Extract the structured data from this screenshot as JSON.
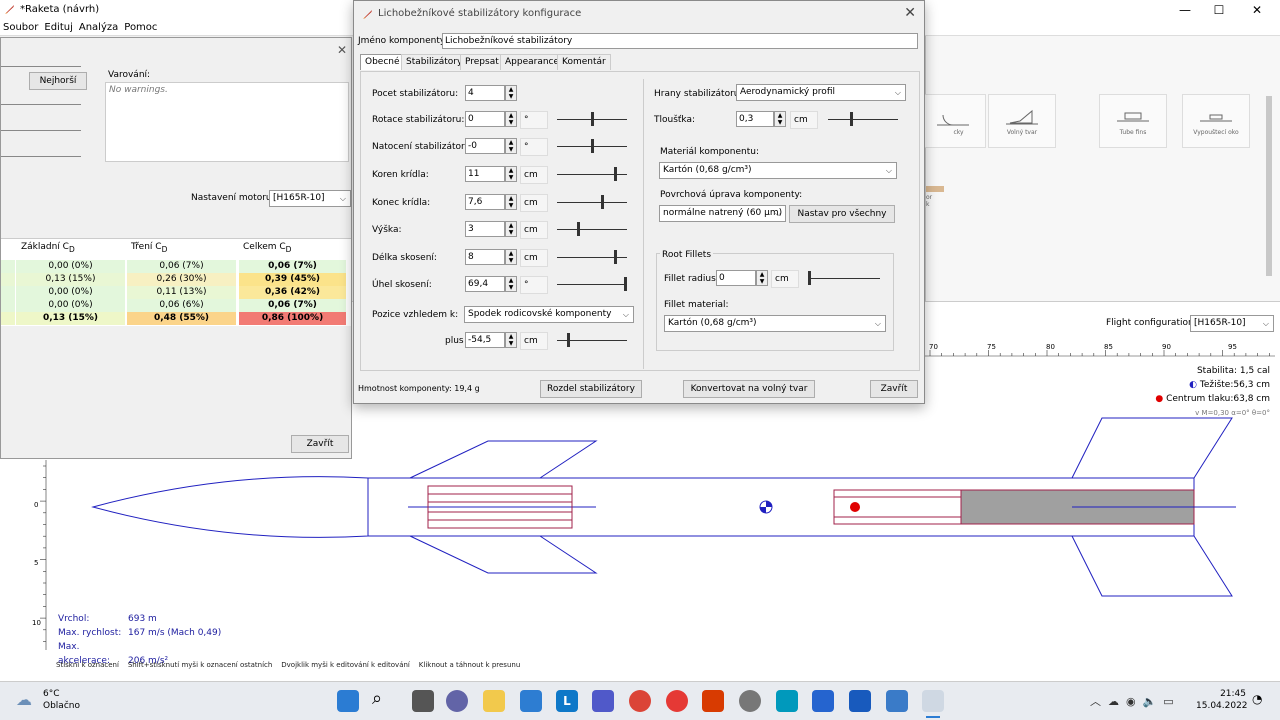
{
  "main_window": {
    "title": "*Raketa (návrh)",
    "controls": {
      "minimize": "—",
      "maximize": "☐",
      "close": "✕"
    },
    "menu": [
      "Soubor",
      "Edituj",
      "Analýza",
      "Pomoc"
    ]
  },
  "analysis_dialog": {
    "worst_button": "Nejhorší",
    "warnings_label": "Varování:",
    "warnings_text": "No warnings.",
    "motor_label": "Nastavení motoru:",
    "motor_value": "[H165R-10]",
    "close_button": "Zavřít",
    "columns": [
      {
        "main": "Základní C",
        "sub": "D"
      },
      {
        "main": "Tření C",
        "sub": "D"
      },
      {
        "main": "Celkem C",
        "sub": "D"
      }
    ],
    "rows": [
      {
        "cells": [
          "0,00 (0%)",
          "0,06 (7%)",
          "0,06 (7%)"
        ],
        "colors": [
          "#e3f7dc",
          "#e3f7dc",
          "#e3f7dc"
        ]
      },
      {
        "cells": [
          "0,13 (15%)",
          "0,26 (30%)",
          "0,39 (45%)"
        ],
        "colors": [
          "#e9f7d4",
          "#f7f0c2",
          "#fbe38a"
        ]
      },
      {
        "cells": [
          "0,00 (0%)",
          "0,11 (13%)",
          "0,36 (42%)"
        ],
        "colors": [
          "#e3f7dc",
          "#e9f7d4",
          "#fbe89a"
        ]
      },
      {
        "cells": [
          "0,00 (0%)",
          "0,06 (6%)",
          "0,06 (7%)"
        ],
        "colors": [
          "#e3f7dc",
          "#e3f7dc",
          "#e3f7dc"
        ]
      },
      {
        "cells": [
          "0,13 (15%)",
          "0,48 (55%)",
          "0,86 (100%)"
        ],
        "colors": [
          "#eef7c8",
          "#fbd48a",
          "#f27b74"
        ]
      }
    ]
  },
  "fin_dialog": {
    "title": "Lichobežníkové stabilizátory konfigurace",
    "component_name_label": "Jméno komponenty:",
    "component_name_value": "Lichobežníkové stabilizátory",
    "tabs": [
      "Obecné",
      "Stabilizátory",
      "Prepsat",
      "Appearance",
      "Komentár"
    ],
    "fields": [
      {
        "label": "Pocet stabilizátoru:",
        "value": "4",
        "unit": "",
        "slider": null
      },
      {
        "label": "Rotace stabilizátoru:",
        "value": "0",
        "unit": "°",
        "slider": 0.5
      },
      {
        "label": "Natocení stabilizátoru:",
        "value": "-0",
        "unit": "°",
        "slider": 0.5
      },
      {
        "label": "Koren krídla:",
        "value": "11",
        "unit": "cm",
        "slider": 0.85
      },
      {
        "label": "Konec krídla:",
        "value": "7,6",
        "unit": "cm",
        "slider": 0.65
      },
      {
        "label": "Výška:",
        "value": "3",
        "unit": "cm",
        "slider": 0.3
      },
      {
        "label": "Délka skosení:",
        "value": "8",
        "unit": "cm",
        "slider": 0.85
      },
      {
        "label": "Úhel skosení:",
        "value": "69,4",
        "unit": "°",
        "slider": 1.0
      }
    ],
    "position_label": "Pozice vzhledem k:",
    "position_value": "Spodek rodicovské komponenty",
    "plus_label": "plus",
    "plus_value": "-54,5",
    "plus_unit": "cm",
    "edges_label": "Hrany stabilizátoru:",
    "edges_value": "Aerodynamický profil",
    "thickness_label": "Tloušťka:",
    "thickness_value": "0,3",
    "thickness_unit": "cm",
    "material_label": "Materiál komponentu:",
    "material_value": "Kartón (0,68 g/cm³)",
    "finish_label": "Povrchová úprava komponenty:",
    "finish_value": "normálne natrený (60 μm)",
    "set_all_button": "Nastav pro všechny",
    "root_fillets_label": "Root Fillets",
    "fillet_radius_label": "Fillet radius:",
    "fillet_radius_value": "0",
    "fillet_radius_unit": "cm",
    "fillet_material_label": "Fillet material:",
    "fillet_material_value": "Kartón (0,68 g/cm³)",
    "mass_label": "Hmotnost komponenty: 19,4 g",
    "split_button": "Rozdel stabilizátory",
    "convert_button": "Konvertovat na volný tvar",
    "close_button": "Zavřít"
  },
  "component_tiles": [
    {
      "label": "cky"
    },
    {
      "label": "Volný tvar"
    },
    {
      "label": "Tube fins"
    },
    {
      "label": "Vypouštecí oko"
    }
  ],
  "tile_extra": {
    "line1": "or",
    "line2": "k"
  },
  "flight_config": {
    "label": "Flight configuration:",
    "value": "[H165R-10]"
  },
  "ruler": [
    "70",
    "75",
    "80",
    "85",
    "90",
    "95"
  ],
  "left_ruler": [
    "0",
    "5",
    "10"
  ],
  "stability": {
    "stability_text": "Stabilita:  1,5 cal",
    "cg_text": "Težište:56,3 cm",
    "cp_text": "Centrum tlaku:63,8 cm",
    "conditions_text": "v M=0,30  α=0° θ=0°"
  },
  "flight_stats": [
    {
      "label": "Vrchol:",
      "value": "693 m"
    },
    {
      "label": "Max. rychlost:",
      "value": "167 m/s  (Mach 0,49)"
    },
    {
      "label": "Max. akcelerace:",
      "value": "206 m/s²"
    }
  ],
  "status_bar": [
    "Stiskni k oznacení",
    "Shift+stisknutí myši k oznacení ostatních",
    "Dvojklik myši k editování k editování",
    "Kliknout a táhnout k presunu"
  ],
  "taskbar": {
    "weather_temp": "6°C",
    "weather_desc": "Oblačno",
    "time": "21:45",
    "date": "15.04.2022"
  }
}
